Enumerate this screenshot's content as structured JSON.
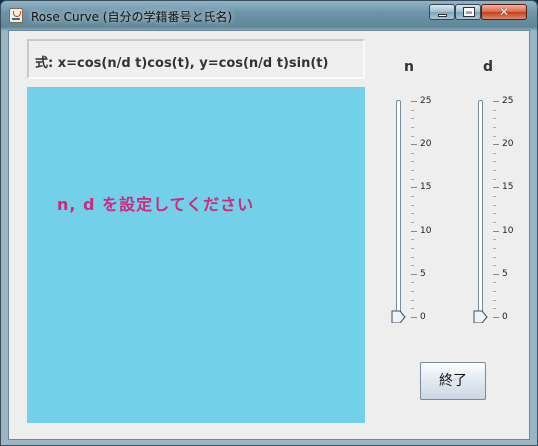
{
  "window": {
    "title": "Rose Curve (自分の学籍番号と氏名)",
    "controls": {
      "minimize": "minimize",
      "maximize": "maximize",
      "close": "✕"
    }
  },
  "formula": {
    "text": "式: x=cos(n/d t)cos(t),  y=cos(n/d t)sin(t)"
  },
  "canvas": {
    "background": "#72d0e8",
    "prompt": "n, d を設定してください",
    "prompt_color": "#d0287e"
  },
  "sliders": [
    {
      "label": "n",
      "value": 0,
      "min": 0,
      "max": 25,
      "tick_labels": [
        "25",
        "20",
        "15",
        "10",
        "5",
        "0"
      ]
    },
    {
      "label": "d",
      "value": 0,
      "min": 0,
      "max": 25,
      "tick_labels": [
        "25",
        "20",
        "15",
        "10",
        "5",
        "0"
      ]
    }
  ],
  "exit_button": {
    "label": "終了"
  }
}
